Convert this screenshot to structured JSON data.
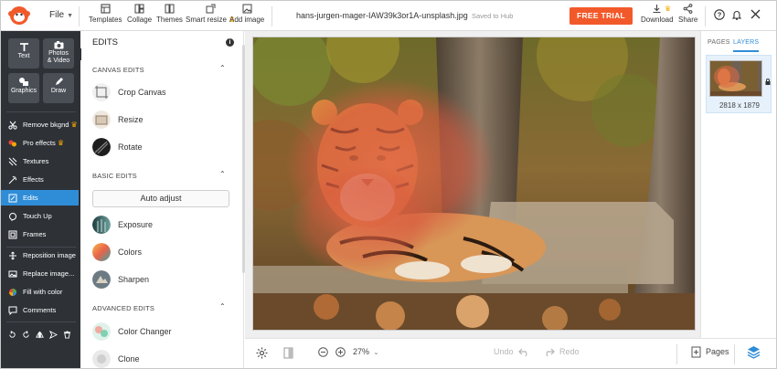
{
  "topbar": {
    "file_label": "File",
    "tools": [
      {
        "label": "Templates",
        "icon": "templates-icon"
      },
      {
        "label": "Collage",
        "icon": "collage-icon"
      },
      {
        "label": "Themes",
        "icon": "themes-icon"
      },
      {
        "label": "Smart resize",
        "icon": "smart-resize-icon"
      },
      {
        "label": "Add image",
        "icon": "add-image-icon"
      }
    ],
    "filename": "hans-jurgen-mager-IAW39k3or1A-unsplash.jpg",
    "saved_status": "Saved to Hub",
    "free_trial_label": "FREE TRIAL",
    "download_label": "Download",
    "share_label": "Share"
  },
  "rail": {
    "tiles": [
      {
        "label": "Text",
        "icon": "text-icon"
      },
      {
        "label": "Photos\n& Video",
        "icon": "photos-icon"
      },
      {
        "label": "Graphics",
        "icon": "graphics-icon"
      },
      {
        "label": "Draw",
        "icon": "draw-icon"
      }
    ],
    "items": [
      {
        "label": "Remove bkgnd",
        "icon": "scissors-icon",
        "premium": true
      },
      {
        "label": "Pro effects",
        "icon": "pro-effects-icon",
        "premium": true
      },
      {
        "label": "Textures",
        "icon": "textures-icon"
      },
      {
        "label": "Effects",
        "icon": "effects-icon"
      },
      {
        "label": "Edits",
        "icon": "edits-icon",
        "active": true
      },
      {
        "label": "Touch Up",
        "icon": "touch-up-icon"
      },
      {
        "label": "Frames",
        "icon": "frames-icon"
      },
      {
        "label": "Reposition image",
        "icon": "reposition-icon"
      },
      {
        "label": "Replace image...",
        "icon": "replace-icon"
      },
      {
        "label": "Fill with color",
        "icon": "fill-color-icon"
      },
      {
        "label": "Comments",
        "icon": "comments-icon"
      }
    ]
  },
  "panel": {
    "title": "EDITS",
    "canvas_edits": {
      "heading": "CANVAS EDITS",
      "items": [
        "Crop Canvas",
        "Resize",
        "Rotate"
      ]
    },
    "basic_edits": {
      "heading": "BASIC EDITS",
      "auto_adjust": "Auto adjust",
      "items": [
        "Exposure",
        "Colors",
        "Sharpen"
      ]
    },
    "advanced_edits": {
      "heading": "ADVANCED EDITS",
      "items": [
        "Color Changer",
        "Clone"
      ]
    }
  },
  "bottombar": {
    "zoom": "27%",
    "undo_label": "Undo",
    "redo_label": "Redo",
    "pages_label": "Pages"
  },
  "rpanel": {
    "tab_pages": "PAGES",
    "tab_layers": "LAYERS",
    "layer_dims": "2818 x 1879"
  },
  "colors": {
    "accent": "#2f8dd8",
    "trial": "#f2592a",
    "rail_bg": "#2e3237",
    "premium_crown": "#f5a800"
  }
}
